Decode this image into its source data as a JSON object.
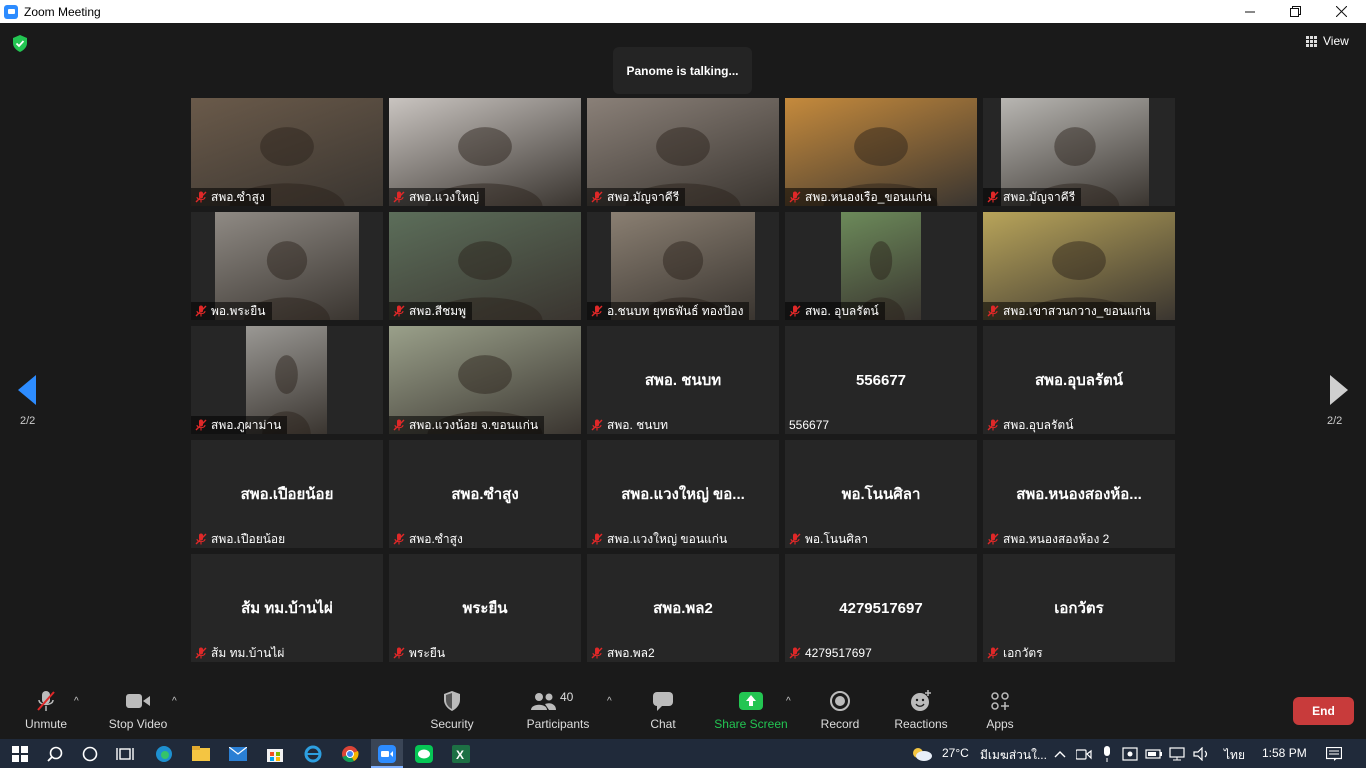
{
  "window": {
    "title": "Zoom Meeting"
  },
  "meeting": {
    "talking_indicator": "Panome is talking...",
    "view_label": "View",
    "page_left": "2/2",
    "page_right": "2/2"
  },
  "tiles": [
    {
      "label": "สพอ.ซำสูง",
      "video": true,
      "center": "",
      "bg": "#6a5a4a"
    },
    {
      "label": "สพอ.แวงใหญ่",
      "video": true,
      "center": "",
      "bg": "#c9c4c0"
    },
    {
      "label": "สพอ.มัญจาคีรี",
      "video": true,
      "center": "",
      "bg": "#8a8078"
    },
    {
      "label": "สพอ.หนองเรือ_ขอนแก่น",
      "video": true,
      "center": "",
      "bg": "#c58a3c"
    },
    {
      "label": "สพอ.มัญจาคีรี",
      "video": true,
      "center": "",
      "bg": "#b8b6b2"
    },
    {
      "label": "พอ.พระยืน",
      "video": true,
      "center": "",
      "bg": "#8f8a84"
    },
    {
      "label": "สพอ.สีชมพู",
      "video": true,
      "center": "",
      "bg": "#5c6e5a"
    },
    {
      "label": "อ.ชนบท ยุทธพันธ์ ทองป้อง",
      "video": true,
      "center": "",
      "bg": "#8a7f72"
    },
    {
      "label": "สพอ. อุบลรัตน์",
      "video": true,
      "center": "",
      "bg": "#6c8a5a"
    },
    {
      "label": "สพอ.เขาสวนกวาง_ขอนแก่น",
      "video": true,
      "center": "",
      "bg": "#b8a45a"
    },
    {
      "label": "สพอ.ภูผาม่าน",
      "video": true,
      "center": "",
      "bg": "#9a9894"
    },
    {
      "label": "สพอ.แวงน้อย จ.ขอนแก่น",
      "video": true,
      "center": "",
      "bg": "#9aa08a"
    },
    {
      "label": "สพอ. ชนบท",
      "video": false,
      "center": "สพอ. ชนบท"
    },
    {
      "label": "556677",
      "video": false,
      "center": "556677",
      "nomic": true
    },
    {
      "label": "สพอ.อุบลรัตน์",
      "video": false,
      "center": "สพอ.อุบลรัตน์"
    },
    {
      "label": "สพอ.เปือยน้อย",
      "video": false,
      "center": "สพอ.เปือยน้อย"
    },
    {
      "label": "สพอ.ซำสูง",
      "video": false,
      "center": "สพอ.ซำสูง"
    },
    {
      "label": "สพอ.แวงใหญ่ ขอนแก่น",
      "video": false,
      "center": "สพอ.แวงใหญ่ ขอ..."
    },
    {
      "label": "พอ.โนนศิลา",
      "video": false,
      "center": "พอ.โนนศิลา"
    },
    {
      "label": "สพอ.หนองสองห้อง 2",
      "video": false,
      "center": "สพอ.หนองสองห้อ..."
    },
    {
      "label": "ส้ม ทม.บ้านไผ่",
      "video": false,
      "center": "ส้ม ทม.บ้านไผ่"
    },
    {
      "label": "พระยืน",
      "video": false,
      "center": "พระยืน"
    },
    {
      "label": "สพอ.พล2",
      "video": false,
      "center": "สพอ.พล2"
    },
    {
      "label": "4279517697",
      "video": false,
      "center": "4279517697"
    },
    {
      "label": "เอกวัตร",
      "video": false,
      "center": "เอกวัตร"
    }
  ],
  "toolbar": {
    "unmute": "Unmute",
    "stop_video": "Stop Video",
    "security": "Security",
    "participants": "Participants",
    "participants_count": "40",
    "chat": "Chat",
    "share_screen": "Share Screen",
    "record": "Record",
    "reactions": "Reactions",
    "apps": "Apps",
    "end": "End"
  },
  "taskbar": {
    "weather": "27°C",
    "weather_text": "มีเมฆส่วนใ...",
    "language": "ไทย",
    "time": "1:58 PM"
  },
  "colors": {
    "accent": "#2d8cff",
    "share_green": "#23c552",
    "end_red": "#c83b3b",
    "mic_off_red": "#e02828"
  }
}
